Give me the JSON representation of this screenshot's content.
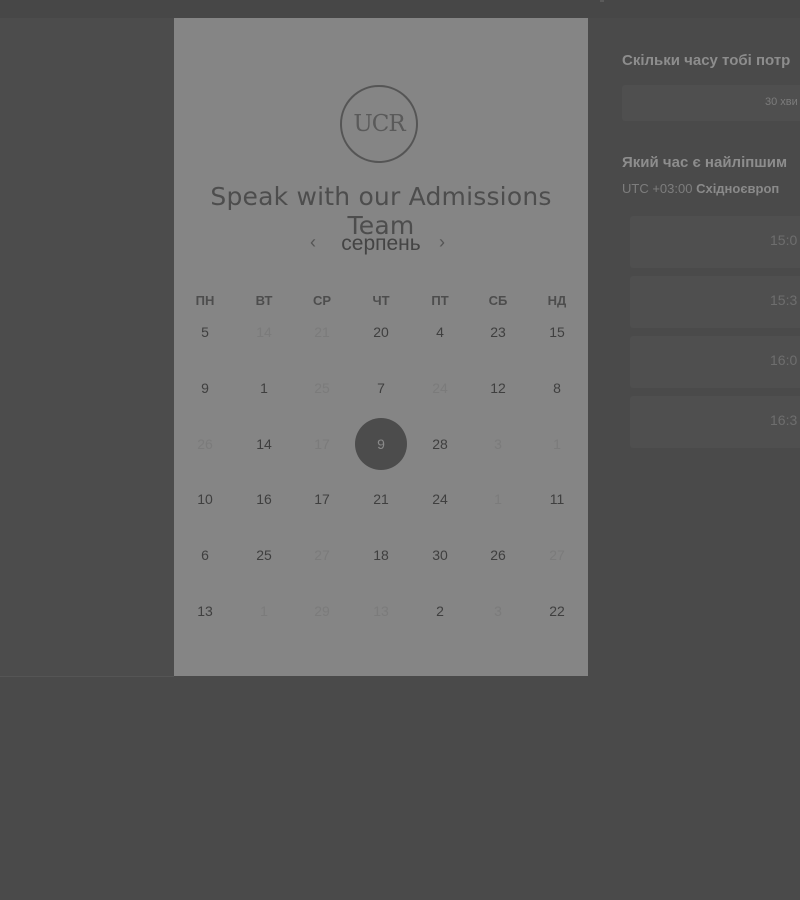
{
  "card": {
    "logo_text": "UCR",
    "title": "Speak with our Admissions Team",
    "month_label": "серпень",
    "prev_icon": "‹",
    "next_icon": "›",
    "weekdays": [
      "ПН",
      "ВТ",
      "СР",
      "ЧТ",
      "ПТ",
      "СБ",
      "НД"
    ],
    "weeks": [
      [
        {
          "d": "5",
          "s": "n"
        },
        {
          "d": "14",
          "s": "m"
        },
        {
          "d": "21",
          "s": "m"
        },
        {
          "d": "20",
          "s": "n"
        },
        {
          "d": "4",
          "s": "n"
        },
        {
          "d": "23",
          "s": "n"
        },
        {
          "d": "15",
          "s": "n"
        }
      ],
      [
        {
          "d": "9",
          "s": "n"
        },
        {
          "d": "1",
          "s": "n"
        },
        {
          "d": "25",
          "s": "m"
        },
        {
          "d": "7",
          "s": "n"
        },
        {
          "d": "24",
          "s": "m"
        },
        {
          "d": "12",
          "s": "n"
        },
        {
          "d": "8",
          "s": "n"
        }
      ],
      [
        {
          "d": "26",
          "s": "m"
        },
        {
          "d": "14",
          "s": "n"
        },
        {
          "d": "17",
          "s": "m"
        },
        {
          "d": "9",
          "s": "sel"
        },
        {
          "d": "28",
          "s": "n"
        },
        {
          "d": "3",
          "s": "m"
        },
        {
          "d": "1",
          "s": "m"
        }
      ],
      [
        {
          "d": "10",
          "s": "n"
        },
        {
          "d": "16",
          "s": "n"
        },
        {
          "d": "17",
          "s": "n"
        },
        {
          "d": "21",
          "s": "n"
        },
        {
          "d": "24",
          "s": "n"
        },
        {
          "d": "1",
          "s": "m"
        },
        {
          "d": "11",
          "s": "n"
        }
      ],
      [
        {
          "d": "6",
          "s": "n"
        },
        {
          "d": "25",
          "s": "n"
        },
        {
          "d": "27",
          "s": "m"
        },
        {
          "d": "18",
          "s": "n"
        },
        {
          "d": "30",
          "s": "n"
        },
        {
          "d": "26",
          "s": "n"
        },
        {
          "d": "27",
          "s": "m"
        }
      ],
      [
        {
          "d": "13",
          "s": "n"
        },
        {
          "d": "1",
          "s": "m"
        },
        {
          "d": "29",
          "s": "m"
        },
        {
          "d": "13",
          "s": "m"
        },
        {
          "d": "2",
          "s": "n"
        },
        {
          "d": "3",
          "s": "m"
        },
        {
          "d": "22",
          "s": "n"
        }
      ]
    ]
  },
  "right": {
    "duration_question": "Скільки часу тобі потр",
    "duration_value": "30 хви",
    "time_question": "Який час є найліпшим",
    "timezone_prefix": "UTC +03:00",
    "timezone_name": "Східноєвроп",
    "slots": [
      "15:0",
      "15:3",
      "16:0",
      "16:3"
    ]
  },
  "colors": {
    "background": "#4a4a4a",
    "card": "#858585",
    "selected_day": "#4c4c4c"
  }
}
